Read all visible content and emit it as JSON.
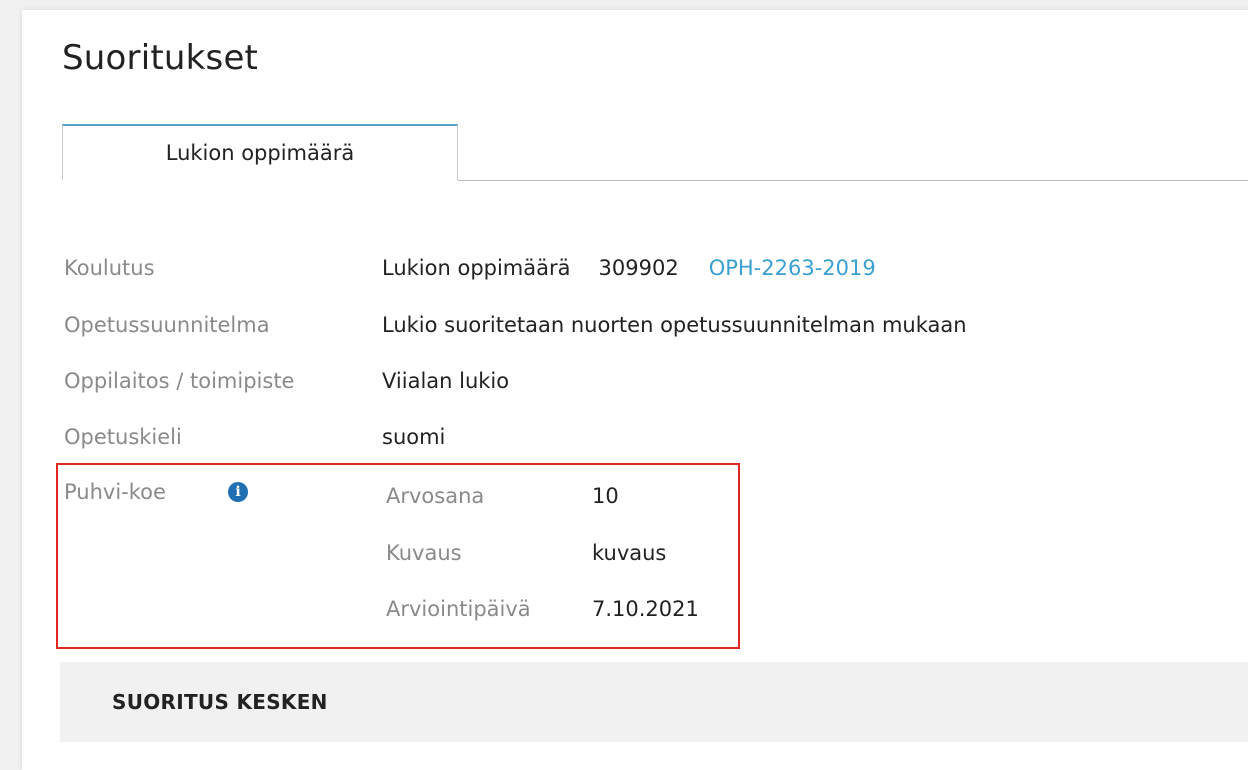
{
  "page": {
    "title": "Suoritukset"
  },
  "tabs": [
    {
      "label": "Lukion oppimäärä",
      "active": true
    }
  ],
  "details": {
    "koulutus": {
      "label": "Koulutus",
      "name": "Lukion oppimäärä",
      "code": "309902",
      "diaarinumero": "OPH-2263-2019"
    },
    "opetussuunnitelma": {
      "label": "Opetussuunnitelma",
      "value": "Lukio suoritetaan nuorten opetussuunnitelman mukaan"
    },
    "oppilaitos": {
      "label": "Oppilaitos / toimipiste",
      "value": "Viialan lukio"
    },
    "opetuskieli": {
      "label": "Opetuskieli",
      "value": "suomi"
    }
  },
  "puhvi": {
    "label": "Puhvi-koe",
    "info_icon": "info-circle-icon",
    "arvosana": {
      "label": "Arvosana",
      "value": "10"
    },
    "kuvaus": {
      "label": "Kuvaus",
      "value": "kuvaus"
    },
    "arviointipaiva": {
      "label": "Arviointipäivä",
      "value": "7.10.2021"
    }
  },
  "status": {
    "text": "SUORITUS KESKEN"
  },
  "colors": {
    "link": "#3a9fd1",
    "tab_accent": "#5ba3c6",
    "highlight_border": "#e3251f",
    "info_icon": "#1f6fb2",
    "label": "#8a8a8a",
    "status_bg": "#f1f1f1"
  }
}
